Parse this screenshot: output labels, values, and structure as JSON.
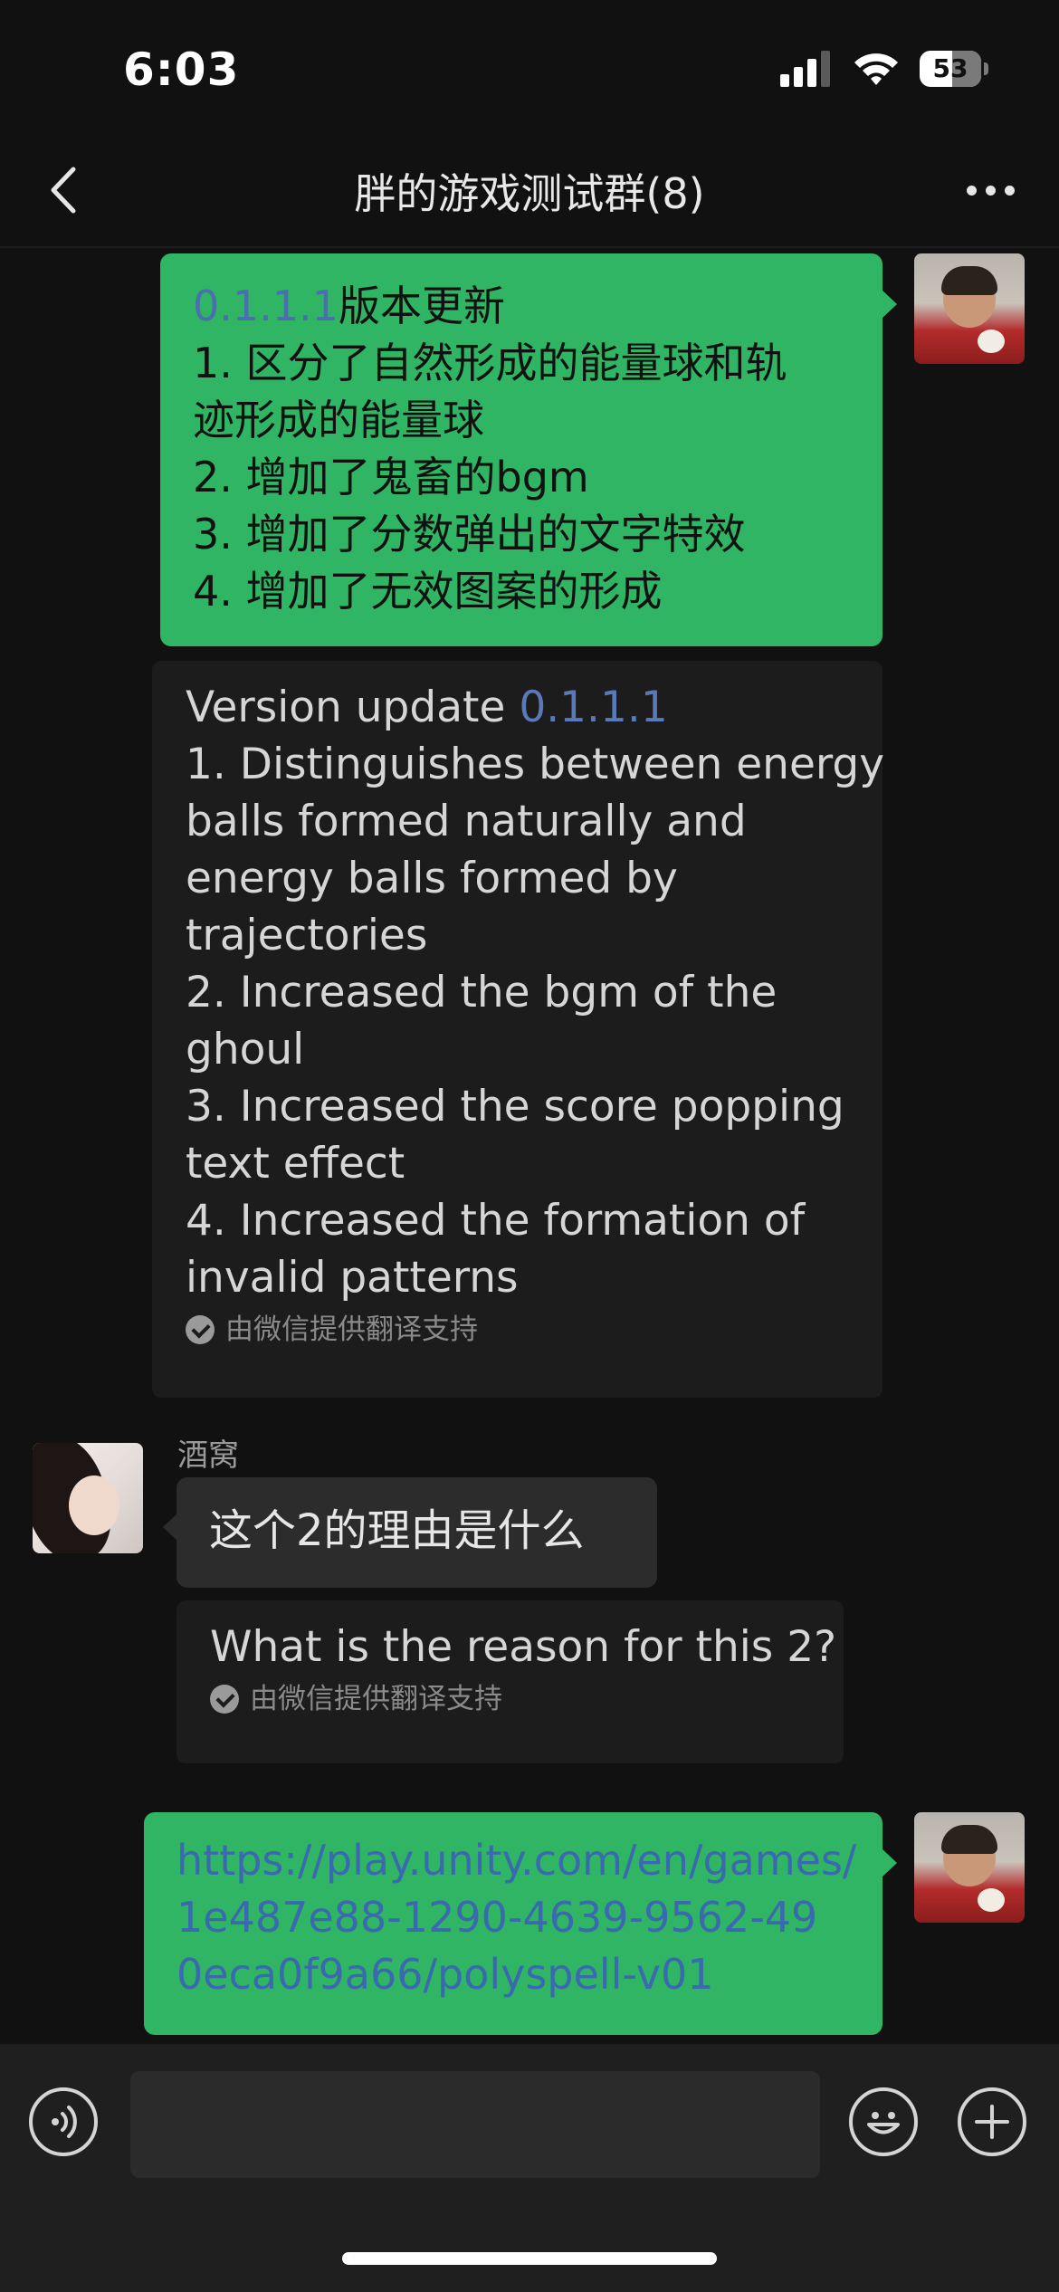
{
  "status_bar": {
    "time": "6:03",
    "battery_level": "53",
    "battery_fraction": 0.53
  },
  "nav": {
    "title": "胖的游戏测试群(8)"
  },
  "messages": {
    "m1": {
      "version": "0.1.1.1",
      "heading_rest": "版本更新",
      "lines": [
        "1. 区分了自然形成的能量球和轨",
        "迹形成的能量球",
        "2. 增加了鬼畜的bgm",
        "3. 增加了分数弹出的文字特效",
        "4. 增加了无效图案的形成"
      ]
    },
    "m1_translation": {
      "prefix": "Version update ",
      "version": "0.1.1.1",
      "lines": [
        "1. Distinguishes between energy",
        "balls formed naturally and",
        "energy balls formed by",
        "trajectories",
        "2. Increased the bgm of the",
        "ghoul",
        "3. Increased the score popping",
        "text effect",
        "4. Increased the formation of",
        "invalid patterns"
      ],
      "credit": "由微信提供翻译支持"
    },
    "m2": {
      "sender": "酒窝",
      "text": "这个2的理由是什么"
    },
    "m2_translation": {
      "text": "What is the reason for this 2?",
      "credit": "由微信提供翻译支持"
    },
    "m3": {
      "lines": [
        "https://play.unity.com/en/games/",
        "1e487e88-1290-4639-9562-49",
        "0eca0f9a66/polyspell-v01"
      ]
    }
  },
  "input": {
    "placeholder": ""
  },
  "icons": {
    "back": "chevron-left-icon",
    "more": "more-icon",
    "voice": "voice-icon",
    "emoji": "emoji-icon",
    "plus": "plus-icon",
    "check": "check-circle-icon"
  },
  "colors": {
    "green_bubble": "#2fb563",
    "grey_bubble": "#2c2c2c",
    "link": "#3b69b0",
    "background": "#111111"
  }
}
